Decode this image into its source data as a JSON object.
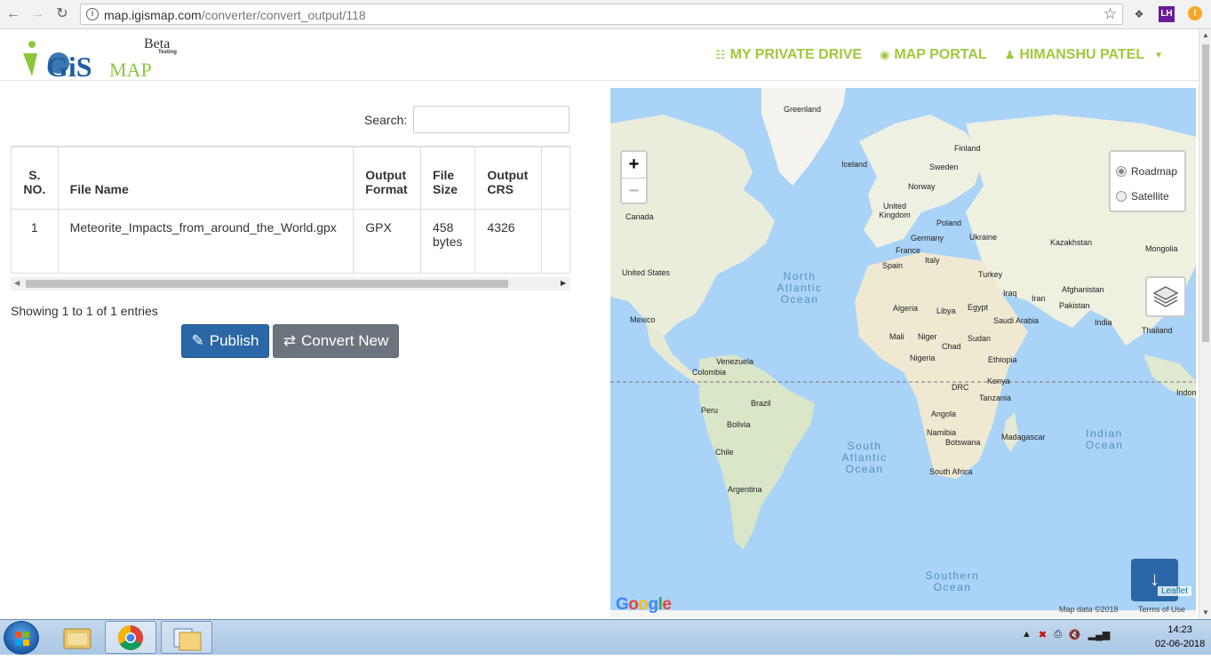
{
  "browser": {
    "url_host": "map.igismap.com",
    "url_path": "/converter/convert_output/118",
    "ext1": "LH"
  },
  "header": {
    "logo_main": "GiS",
    "logo_sub": "MAP",
    "logo_beta": "Beta",
    "logo_testing": "Testing",
    "nav": [
      {
        "label": "MY PRIVATE DRIVE",
        "icon": "database-icon"
      },
      {
        "label": "MAP PORTAL",
        "icon": "globe-icon"
      },
      {
        "label": "HIMANSHU PATEL",
        "icon": "user-icon"
      }
    ]
  },
  "table": {
    "search_label": "Search:",
    "search_value": "",
    "columns": [
      "S. NO.",
      "File Name",
      "Output Format",
      "File Size",
      "Output CRS"
    ],
    "rows": [
      [
        "1",
        "Meteorite_Impacts_from_around_the_World.gpx",
        "GPX",
        "458 bytes",
        "4326"
      ]
    ],
    "info": "Showing 1 to 1 of 1 entries"
  },
  "actions": {
    "publish_label": "Publish",
    "convert_label": "Convert New"
  },
  "map": {
    "zoom_in": "+",
    "zoom_out": "−",
    "layers": [
      {
        "label": "Roadmap",
        "selected": true
      },
      {
        "label": "Satellite",
        "selected": false
      }
    ],
    "attribution": "Leaflet",
    "google": "Google",
    "map_data": "Map data ©2018",
    "terms": "Terms of Use",
    "labels": [
      "Greenland",
      "Iceland",
      "Finland",
      "Sweden",
      "Norway",
      "United Kingdom",
      "Poland",
      "Germany",
      "Ukraine",
      "France",
      "Italy",
      "Spain",
      "Kazakhstan",
      "Mongolia",
      "Canada",
      "United States",
      "Turkey",
      "Iraq",
      "Iran",
      "Afghanistan",
      "Pakistan",
      "India",
      "Thailand",
      "Mexico",
      "Algeria",
      "Libya",
      "Egypt",
      "Saudi Arabia",
      "Mali",
      "Niger",
      "Chad",
      "Sudan",
      "Nigeria",
      "Ethiopia",
      "Venezuela",
      "Colombia",
      "Kenya",
      "DRC",
      "Tanzania",
      "Peru",
      "Brazil",
      "Angola",
      "Bolivia",
      "Namibia",
      "Botswana",
      "Madagascar",
      "Chile",
      "South Africa",
      "Argentina",
      "Indon"
    ],
    "oceans": [
      "North Atlantic Ocean",
      "South Atlantic Ocean",
      "Indian Ocean",
      "Southern Ocean"
    ]
  },
  "taskbar": {
    "time": "14:23",
    "date": "02-06-2018"
  }
}
